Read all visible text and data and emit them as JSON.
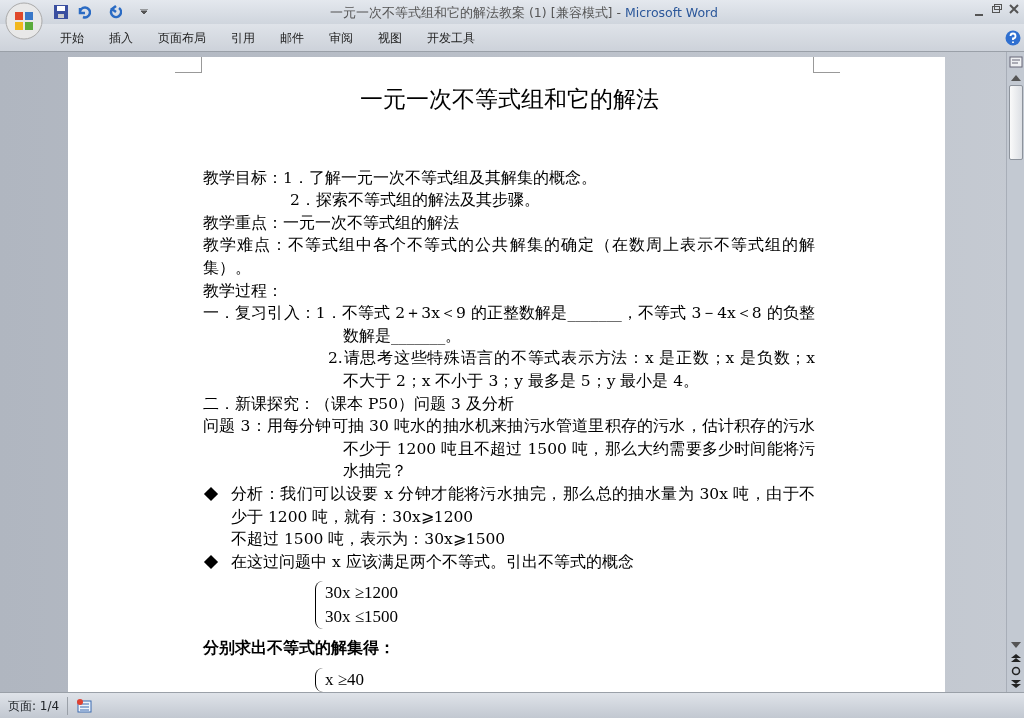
{
  "window": {
    "title": "一元一次不等式组和它的解法教案 (1) [兼容模式]",
    "separator": "-",
    "app_name": "Microsoft Word"
  },
  "ribbon_tabs": [
    "开始",
    "插入",
    "页面布局",
    "引用",
    "邮件",
    "审阅",
    "视图",
    "开发工具"
  ],
  "document": {
    "title": "一元一次不等式组和它的解法",
    "paragraphs": [
      {
        "kind": "plain",
        "text": "教学目标：1．了解一元一次不等式组及其解集的概念。"
      },
      {
        "kind": "indented",
        "text": "2．探索不等式组的解法及其步骤。"
      },
      {
        "kind": "plain",
        "text": "教学重点：一元一次不等式组的解法"
      },
      {
        "kind": "plain",
        "text": "教学难点：不等式组中各个不等式的公共解集的确定（在数周上表示不等式组的解集）。"
      },
      {
        "kind": "plain",
        "text": "教学过程："
      },
      {
        "kind": "hanging",
        "text": "一．复习引入：1．不等式 2＋3x＜9 的正整数解是_______，不等式 3－4x＜8 的负整数解是_______。"
      },
      {
        "kind": "sub",
        "text": "2.请思考这些特殊语言的不等式表示方法：x 是正数；x 是负数；x 不大于 2；x 不小于 3；y 最多是 5；y 最小是 4。"
      },
      {
        "kind": "plain",
        "text": "二．新课探究：（课本 P50）问题 3 及分析"
      },
      {
        "kind": "hanging",
        "text": "问题 3：用每分钟可抽 30 吨水的抽水机来抽污水管道里积存的污水，估计积存的污水不少于 1200 吨且不超过 1500 吨，那么大约需要多少时间能将污水抽完？"
      },
      {
        "kind": "bullet",
        "text": "分析：我们可以设要 x 分钟才能将污水抽完，那么总的抽水量为 30x 吨，由于不少于 1200 吨，就有：30x⩾1200"
      },
      {
        "kind": "continued",
        "text": "不超过 1500 吨，表示为：30x⩾1500"
      },
      {
        "kind": "bullet",
        "text": "在这过问题中 x 应该满足两个不等式。引出不等式的概念"
      },
      {
        "kind": "system",
        "lines": [
          "30x ≥1200",
          "30x ≤1500"
        ]
      },
      {
        "kind": "bold",
        "text": "分别求出不等式的解集得："
      },
      {
        "kind": "system",
        "lines": [
          "x ≥40"
        ]
      }
    ]
  },
  "status_bar": {
    "page": "页面: 1/4"
  }
}
